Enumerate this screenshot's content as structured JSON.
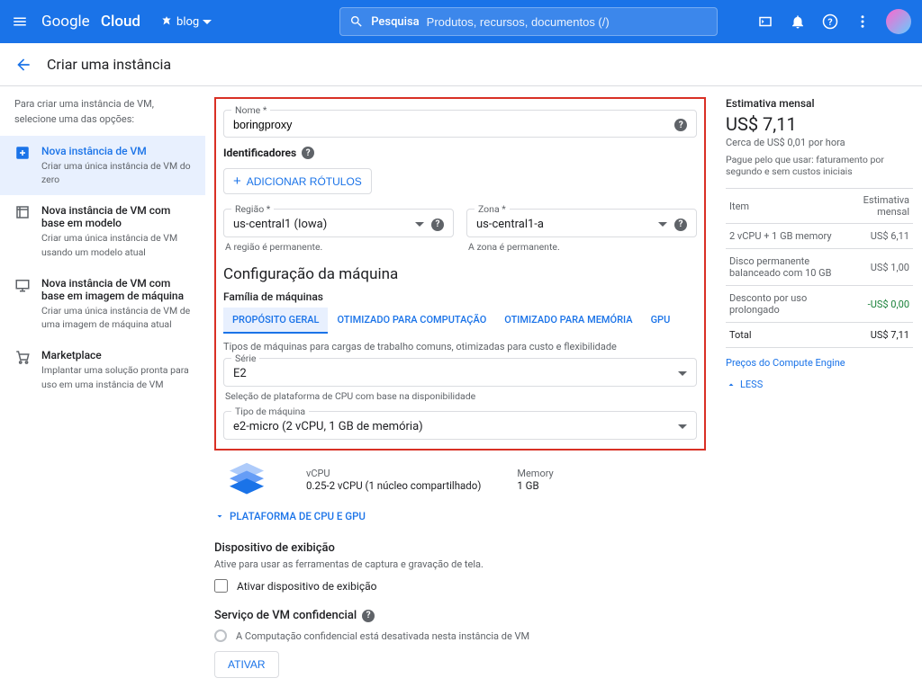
{
  "header": {
    "logo1": "Google",
    "logo2": "Cloud",
    "project": "blog",
    "search_label": "Pesquisa",
    "search_placeholder": "Produtos, recursos, documentos (/)"
  },
  "subheader": {
    "title": "Criar uma instância"
  },
  "sidebar": {
    "desc": "Para criar uma instância de VM, selecione uma das opções:",
    "items": [
      {
        "label": "Nova instância de VM",
        "sub": "Criar uma única instância de VM do zero"
      },
      {
        "label": "Nova instância de VM com base em modelo",
        "sub": "Criar uma única instância de VM usando um modelo atual"
      },
      {
        "label": "Nova instância de VM com base em imagem de máquina",
        "sub": "Criar uma única instância de VM de uma imagem de máquina atual"
      },
      {
        "label": "Marketplace",
        "sub": "Implantar uma solução pronta para uso em uma instância de VM"
      }
    ]
  },
  "form": {
    "name_label": "Nome *",
    "name_value": "boringproxy",
    "identifiers_label": "Identificadores",
    "add_labels": "ADICIONAR RÓTULOS",
    "region_label": "Região *",
    "region_value": "us-central1 (Iowa)",
    "region_helper": "A região é permanente.",
    "zone_label": "Zona *",
    "zone_value": "us-central1-a",
    "zone_helper": "A zona é permanente.",
    "machine_config_title": "Configuração da máquina",
    "family_label": "Família de máquinas",
    "family_tabs": [
      "PROPÓSITO GERAL",
      "OTIMIZADO PARA COMPUTAÇÃO",
      "OTIMIZADO PARA MEMÓRIA",
      "GPU"
    ],
    "family_desc": "Tipos de máquinas para cargas de trabalho comuns, otimizadas para custo e flexibilidade",
    "series_label": "Série",
    "series_value": "E2",
    "series_helper": "Seleção de plataforma de CPU com base na disponibilidade",
    "machine_type_label": "Tipo de máquina",
    "machine_type_value": "e2-micro (2 vCPU, 1 GB de memória)",
    "vcpu_hdr": "vCPU",
    "vcpu_val": "0.25-2 vCPU (1 núcleo compartilhado)",
    "memory_hdr": "Memory",
    "memory_val": "1 GB",
    "platform_expand": "PLATAFORMA DE CPU E GPU",
    "display_title": "Dispositivo de exibição",
    "display_desc": "Ative para usar as ferramentas de captura e gravação de tela.",
    "display_checkbox": "Ativar dispositivo de exibição",
    "confidential_title": "Serviço de VM confidencial",
    "confidential_desc": "A Computação confidencial está desativada nesta instância de VM",
    "activate": "ATIVAR"
  },
  "estimate": {
    "title": "Estimativa mensal",
    "price": "US$ 7,11",
    "per": "Cerca de US$ 0,01 por hora",
    "note": "Pague pelo que usar: faturamento por segundo e sem custos iniciais",
    "col_item": "Item",
    "col_cost": "Estimativa mensal",
    "rows": [
      {
        "item": "2 vCPU + 1 GB memory",
        "cost": "US$ 6,11"
      },
      {
        "item": "Disco permanente balanceado com 10 GB",
        "cost": "US$ 1,00"
      },
      {
        "item": "Desconto por uso prolongado",
        "cost": "-US$ 0,00",
        "discount": true
      }
    ],
    "total_label": "Total",
    "total_value": "US$ 7,11",
    "pricing_link": "Preços do Compute Engine",
    "less": "LESS"
  }
}
